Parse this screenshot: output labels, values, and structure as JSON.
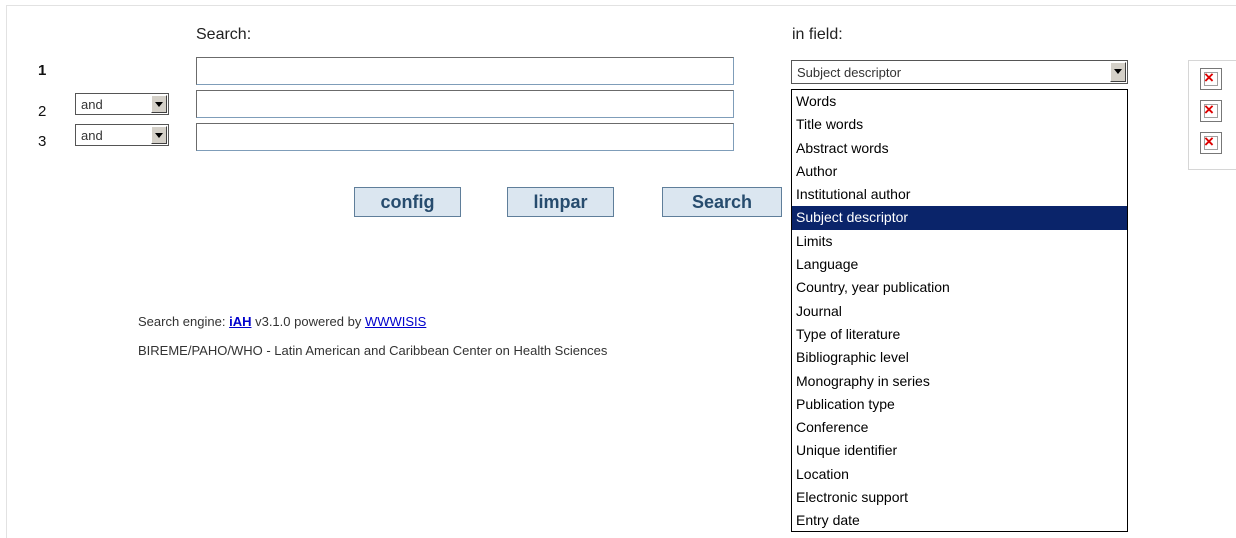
{
  "header": {
    "search_label": "Search:",
    "field_label": "in field:"
  },
  "rows": [
    {
      "num": "1",
      "operator": "",
      "value": ""
    },
    {
      "num": "2",
      "operator": "and",
      "value": ""
    },
    {
      "num": "3",
      "operator": "and",
      "value": ""
    }
  ],
  "field_select": {
    "selected": "Subject descriptor"
  },
  "field_options": [
    "Words",
    "Title words",
    "Abstract words",
    "Author",
    "Institutional author",
    "Subject descriptor",
    "Limits",
    "Language",
    "Country, year publication",
    "Journal",
    "Type of literature",
    "Bibliographic level",
    "Monography in series",
    "Publication type",
    "Conference",
    "Unique identifier",
    "Location",
    "Electronic support",
    "Entry date"
  ],
  "buttons": {
    "config": "config",
    "clear": "limpar",
    "search": "Search"
  },
  "footer": {
    "engine_prefix": "Search engine:",
    "engine_link": "iAH",
    "engine_mid": "v3.1.0 powered by",
    "engine_powered_link": "WWWISIS",
    "org_line": "BIREME/PAHO/WHO - Latin American and Caribbean Center on Health Sciences"
  }
}
